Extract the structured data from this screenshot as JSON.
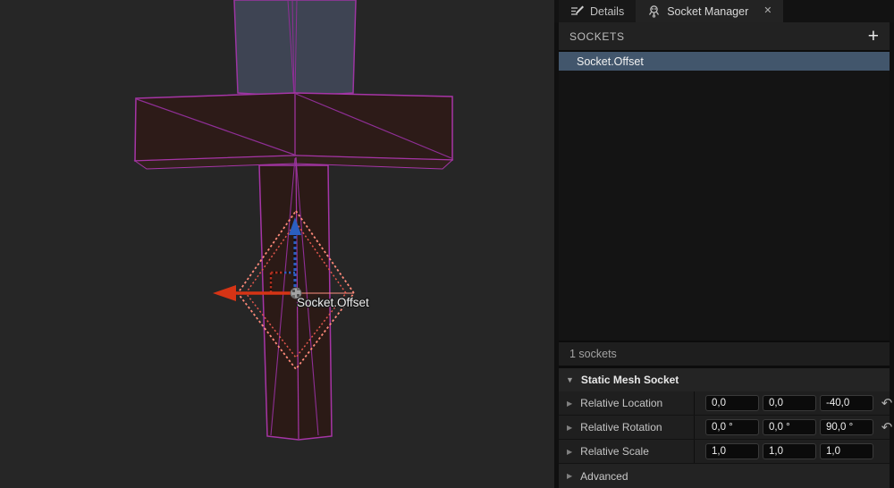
{
  "viewport": {
    "socket_label": "Socket.Offset"
  },
  "panel": {
    "tabs": [
      {
        "label": "Details",
        "icon": "pencil-icon",
        "active": false
      },
      {
        "label": "Socket Manager",
        "icon": "socket-icon",
        "active": true
      }
    ],
    "sockets_header": {
      "title": "SOCKETS",
      "add_label": "+"
    },
    "socket_list": [
      {
        "name": "Socket.Offset",
        "selected": true
      }
    ],
    "status": "1 sockets",
    "details": {
      "section_title": "Static Mesh Socket",
      "rows": [
        {
          "label": "Relative Location",
          "values": [
            "0,0",
            "0,0",
            "-40,0"
          ],
          "has_reset": true
        },
        {
          "label": "Relative Rotation",
          "values": [
            "0,0 °",
            "0,0 °",
            "90,0 °"
          ],
          "has_reset": true
        },
        {
          "label": "Relative Scale",
          "values": [
            "1,0",
            "1,0",
            "1,0"
          ],
          "has_reset": false
        }
      ],
      "advanced_label": "Advanced"
    }
  },
  "icons": {
    "close": "✕",
    "reset": "↶",
    "expander_collapsed": "▶",
    "expander_expanded": "▼"
  },
  "colors": {
    "viewport_bg": "#262626",
    "blade_fill": "#3e4453",
    "guard_fill": "#2d1b18",
    "wire_edge": "#a635a6",
    "selection_blue": "#42566c",
    "gizmo_axis_red": "#d63415",
    "gizmo_axis_blue": "#2b5fc0",
    "gizmo_diamond": "#ff8a7a"
  }
}
